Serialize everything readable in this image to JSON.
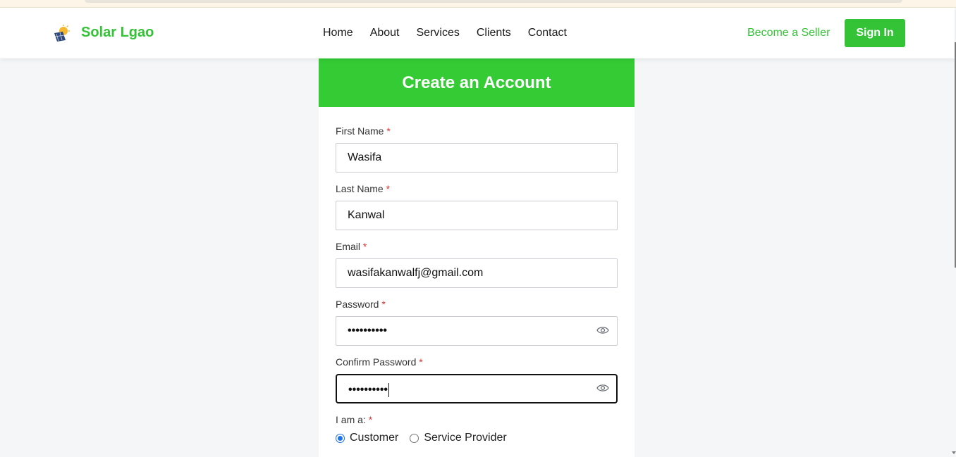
{
  "header": {
    "brand": "Solar Lgao",
    "nav": [
      "Home",
      "About",
      "Services",
      "Clients",
      "Contact"
    ],
    "become_seller": "Become a Seller",
    "sign_in": "Sign In"
  },
  "form": {
    "title": "Create an Account",
    "required_mark": "*",
    "first_name": {
      "label": "First Name",
      "value": "Wasifa"
    },
    "last_name": {
      "label": "Last Name",
      "value": "Kanwal"
    },
    "email": {
      "label": "Email",
      "value": "wasifakanwalfj@gmail.com"
    },
    "password": {
      "label": "Password",
      "masked": "••••••••••"
    },
    "confirm_password": {
      "label": "Confirm Password",
      "masked": "••••••••••"
    },
    "role": {
      "label": "I am a:",
      "options": [
        "Customer",
        "Service Provider"
      ],
      "selected": "Customer"
    }
  },
  "colors": {
    "brand_green": "#34c336",
    "header_green": "#34cb35",
    "radio_blue": "#1a73e8",
    "required_red": "#e0302e"
  },
  "icons": {
    "logo": "solar-panel-sun-logo",
    "toggle_password": "eye-icon"
  }
}
